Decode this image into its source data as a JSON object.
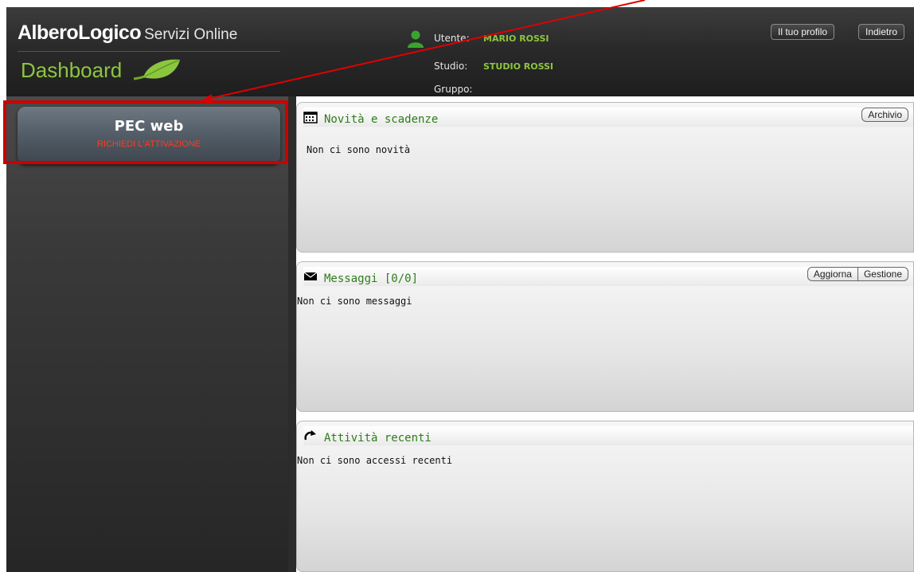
{
  "header": {
    "brand_name": "AlberoLogico",
    "brand_sub": "Servizi Online",
    "section": "Dashboard",
    "user_label": "Utente:",
    "user_value": "MARIO ROSSI",
    "studio_label": "Studio:",
    "studio_value": "STUDIO ROSSI",
    "gruppo_label": "Gruppo:",
    "gruppo_value": "",
    "profile_button": "Il tuo profilo",
    "back_button": "Indietro"
  },
  "sidebar": {
    "service_title": "PEC web",
    "service_action": "RICHIEDI L'ATTIVAZIONE"
  },
  "panels": {
    "news": {
      "title": "Novità e scadenze",
      "body": "Non ci sono novità",
      "archive_button": "Archivio"
    },
    "messages": {
      "title": "Messaggi [0/0]",
      "body": "Non ci sono messaggi",
      "refresh_button": "Aggiorna",
      "manage_button": "Gestione"
    },
    "recent": {
      "title": "Attività recenti",
      "body": "Non ci sono accessi recenti"
    }
  },
  "colors": {
    "accent_green": "#8cc63f",
    "title_green": "#2e7d1a",
    "alert_red": "#ff3b1f",
    "highlight_red": "#cc0000"
  },
  "icons": [
    "user-icon",
    "leaf-icon",
    "calendar-icon",
    "envelope-icon",
    "refresh-icon",
    "annotation-arrow"
  ]
}
